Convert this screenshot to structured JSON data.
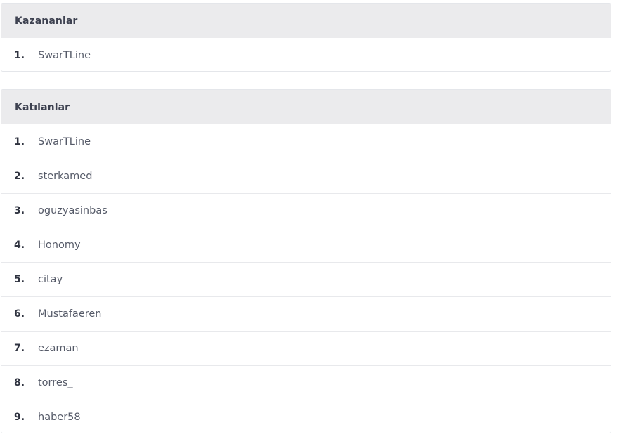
{
  "winners": {
    "title": "Kazananlar",
    "items": [
      {
        "index": "1.",
        "name": "SwarTLine"
      }
    ]
  },
  "participants": {
    "title": "Katılanlar",
    "items": [
      {
        "index": "1.",
        "name": "SwarTLine"
      },
      {
        "index": "2.",
        "name": "sterkamed"
      },
      {
        "index": "3.",
        "name": "oguzyasinbas"
      },
      {
        "index": "4.",
        "name": "Honomy"
      },
      {
        "index": "5.",
        "name": "citay"
      },
      {
        "index": "6.",
        "name": "Mustafaeren"
      },
      {
        "index": "7.",
        "name": "ezaman"
      },
      {
        "index": "8.",
        "name": "torres_"
      },
      {
        "index": "9.",
        "name": "haber58"
      }
    ]
  }
}
